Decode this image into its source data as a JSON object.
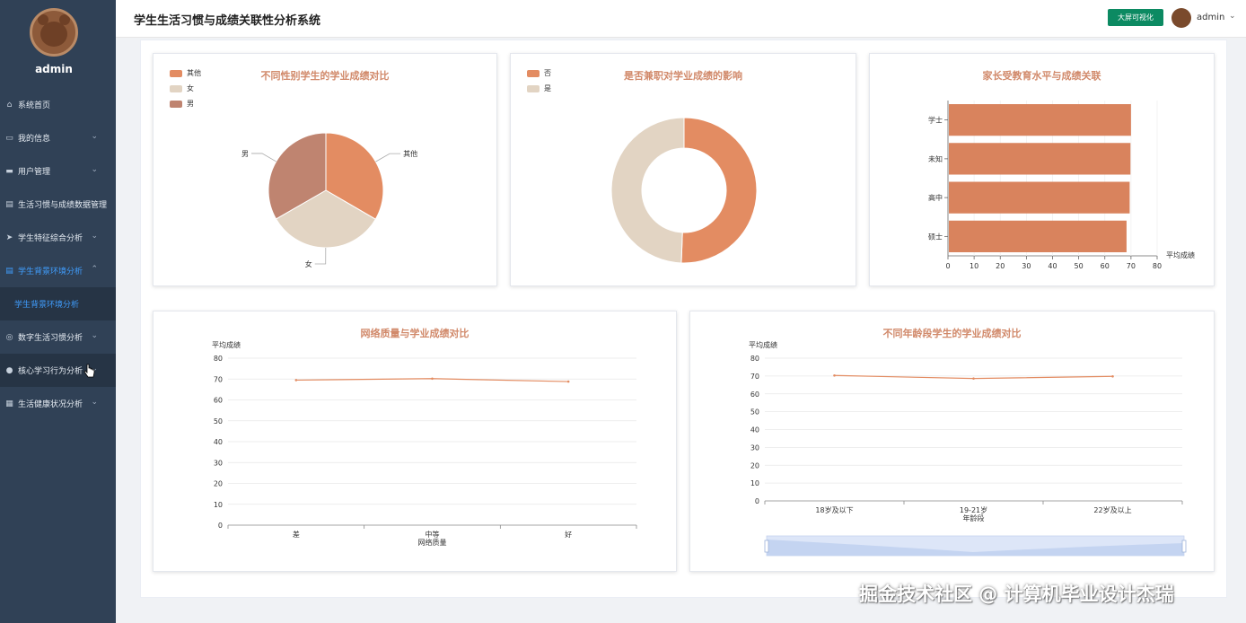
{
  "sidebar": {
    "username": "admin",
    "items": [
      {
        "label": "系统首页",
        "icon": "home-icon",
        "glyph": "⌂",
        "chevron": ""
      },
      {
        "label": "我的信息",
        "icon": "info-icon",
        "glyph": "▭",
        "chevron": "⌄"
      },
      {
        "label": "用户管理",
        "icon": "user-icon",
        "glyph": "▬",
        "chevron": "⌄"
      },
      {
        "label": "生活习惯与成绩数据管理",
        "icon": "clipboard-icon",
        "glyph": "▤",
        "chevron": ""
      },
      {
        "label": "学生特征综合分析",
        "icon": "send-icon",
        "glyph": "➤",
        "chevron": "⌄"
      },
      {
        "label": "学生背景环境分析",
        "icon": "document-icon",
        "glyph": "▤",
        "chevron": "⌃"
      },
      {
        "label": "学生背景环境分析",
        "icon": "",
        "glyph": "",
        "chevron": ""
      },
      {
        "label": "数字生活习惯分析",
        "icon": "circle-icon",
        "glyph": "◎",
        "chevron": "⌄"
      },
      {
        "label": "核心学习行为分析",
        "icon": "location-icon",
        "glyph": "●",
        "chevron": "⌄"
      },
      {
        "label": "生活健康状况分析",
        "icon": "grid-icon",
        "glyph": "▦",
        "chevron": "⌄"
      }
    ]
  },
  "header": {
    "title": "学生生活习惯与成绩关联性分析系统",
    "big_screen_button": "大屏可视化",
    "username": "admin",
    "caret": "⌄"
  },
  "colors": {
    "sidebar_bg": "#304156",
    "accent": "#409eff",
    "chart_orange": "#e38c62",
    "chart_beige": "#e2d4c3",
    "chart_brown": "#bf8470",
    "title_color": "#d1896a",
    "button_green": "#0c8a62"
  },
  "chart_data": [
    {
      "type": "pie",
      "title": "不同性别学生的学业成绩对比",
      "legend": [
        "其他",
        "女",
        "男"
      ],
      "slices": [
        {
          "name": "其他",
          "value": 33.4,
          "color": "#e38c62"
        },
        {
          "name": "女",
          "value": 33.3,
          "color": "#e2d4c3"
        },
        {
          "name": "男",
          "value": 33.3,
          "color": "#bf8470"
        }
      ]
    },
    {
      "type": "pie",
      "title": "是否兼职对学业成绩的影响",
      "legend": [
        "否",
        "是"
      ],
      "slices": [
        {
          "name": "否",
          "value": 50.6,
          "color": "#e38c62"
        },
        {
          "name": "是",
          "value": 49.4,
          "color": "#e2d4c3"
        }
      ]
    },
    {
      "type": "bar",
      "title": "家长受教育水平与成绩关联",
      "orientation": "horizontal",
      "categories": [
        "学士",
        "未知",
        "高中",
        "硕士"
      ],
      "values": [
        70.0,
        69.8,
        69.5,
        68.3
      ],
      "xlabel": "平均成绩",
      "xlim": [
        0,
        80
      ],
      "xticks": [
        "0",
        "10",
        "20",
        "30",
        "40",
        "50",
        "60",
        "70",
        "80"
      ]
    },
    {
      "type": "line",
      "title": "网络质量与学业成绩对比",
      "categories": [
        "差",
        "中等",
        "好"
      ],
      "values": [
        69.5,
        70.2,
        68.8
      ],
      "ylabel": "平均成绩",
      "xlabel": "网络质量",
      "ylim": [
        0,
        80
      ],
      "yticks": [
        "0",
        "10",
        "20",
        "30",
        "40",
        "50",
        "60",
        "70",
        "80"
      ]
    },
    {
      "type": "line",
      "title": "不同年龄段学生的学业成绩对比",
      "categories": [
        "18岁及以下",
        "19-21岁",
        "22岁及以上"
      ],
      "values": [
        70.3,
        68.6,
        69.8
      ],
      "ylabel": "平均成绩",
      "xlabel": "年龄段",
      "ylim": [
        0,
        80
      ],
      "yticks": [
        "0",
        "10",
        "20",
        "30",
        "40",
        "50",
        "60",
        "70",
        "80"
      ]
    }
  ],
  "watermark": "掘金技术社区 @ 计算机毕业设计杰瑞"
}
